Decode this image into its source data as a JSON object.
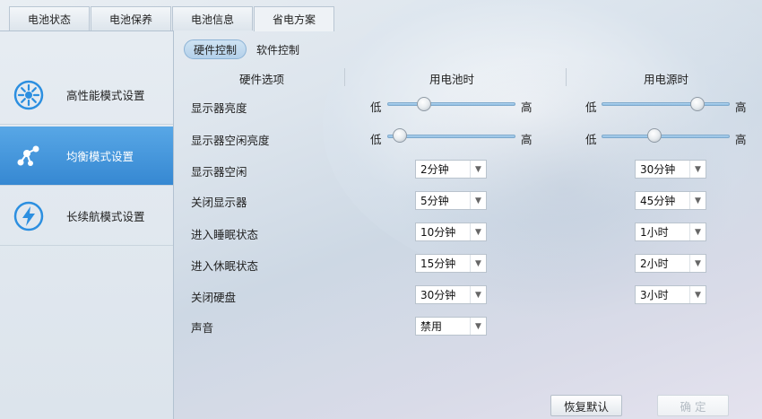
{
  "tabs": [
    {
      "label": "电池状态"
    },
    {
      "label": "电池保养"
    },
    {
      "label": "电池信息"
    },
    {
      "label": "省电方案"
    }
  ],
  "active_tab": 3,
  "modes": [
    {
      "label": "高性能模式设置",
      "icon": "performance-icon"
    },
    {
      "label": "均衡模式设置",
      "icon": "balanced-icon"
    },
    {
      "label": "长续航模式设置",
      "icon": "lightning-icon"
    }
  ],
  "active_mode": 1,
  "subtabs": [
    {
      "label": "硬件控制"
    },
    {
      "label": "软件控制"
    }
  ],
  "columns": {
    "options": "硬件选项",
    "battery": "用电池时",
    "power": "用电源时"
  },
  "slider_labels": {
    "low": "低",
    "high": "高"
  },
  "rows": [
    {
      "label": "显示器亮度",
      "battery_level": 0.29,
      "power_level": 0.75
    },
    {
      "label": "显示器空闲亮度",
      "battery_level": 0.1,
      "power_level": 0.41
    },
    {
      "label": "显示器空闲",
      "battery": "2分钟",
      "power": "30分钟"
    },
    {
      "label": "关闭显示器",
      "battery": "5分钟",
      "power": "45分钟"
    },
    {
      "label": "进入睡眠状态",
      "battery": "10分钟",
      "power": "1小时"
    },
    {
      "label": "进入休眠状态",
      "battery": "15分钟",
      "power": "2小时"
    },
    {
      "label": "关闭硬盘",
      "battery": "30分钟",
      "power": "3小时"
    },
    {
      "label": "声音",
      "battery": "禁用"
    }
  ],
  "buttons": {
    "restore": "恢复默认",
    "confirm": "确 定"
  },
  "colors": {
    "accent": "#3a8ad3",
    "icon_blue": "#2c8fe0"
  }
}
